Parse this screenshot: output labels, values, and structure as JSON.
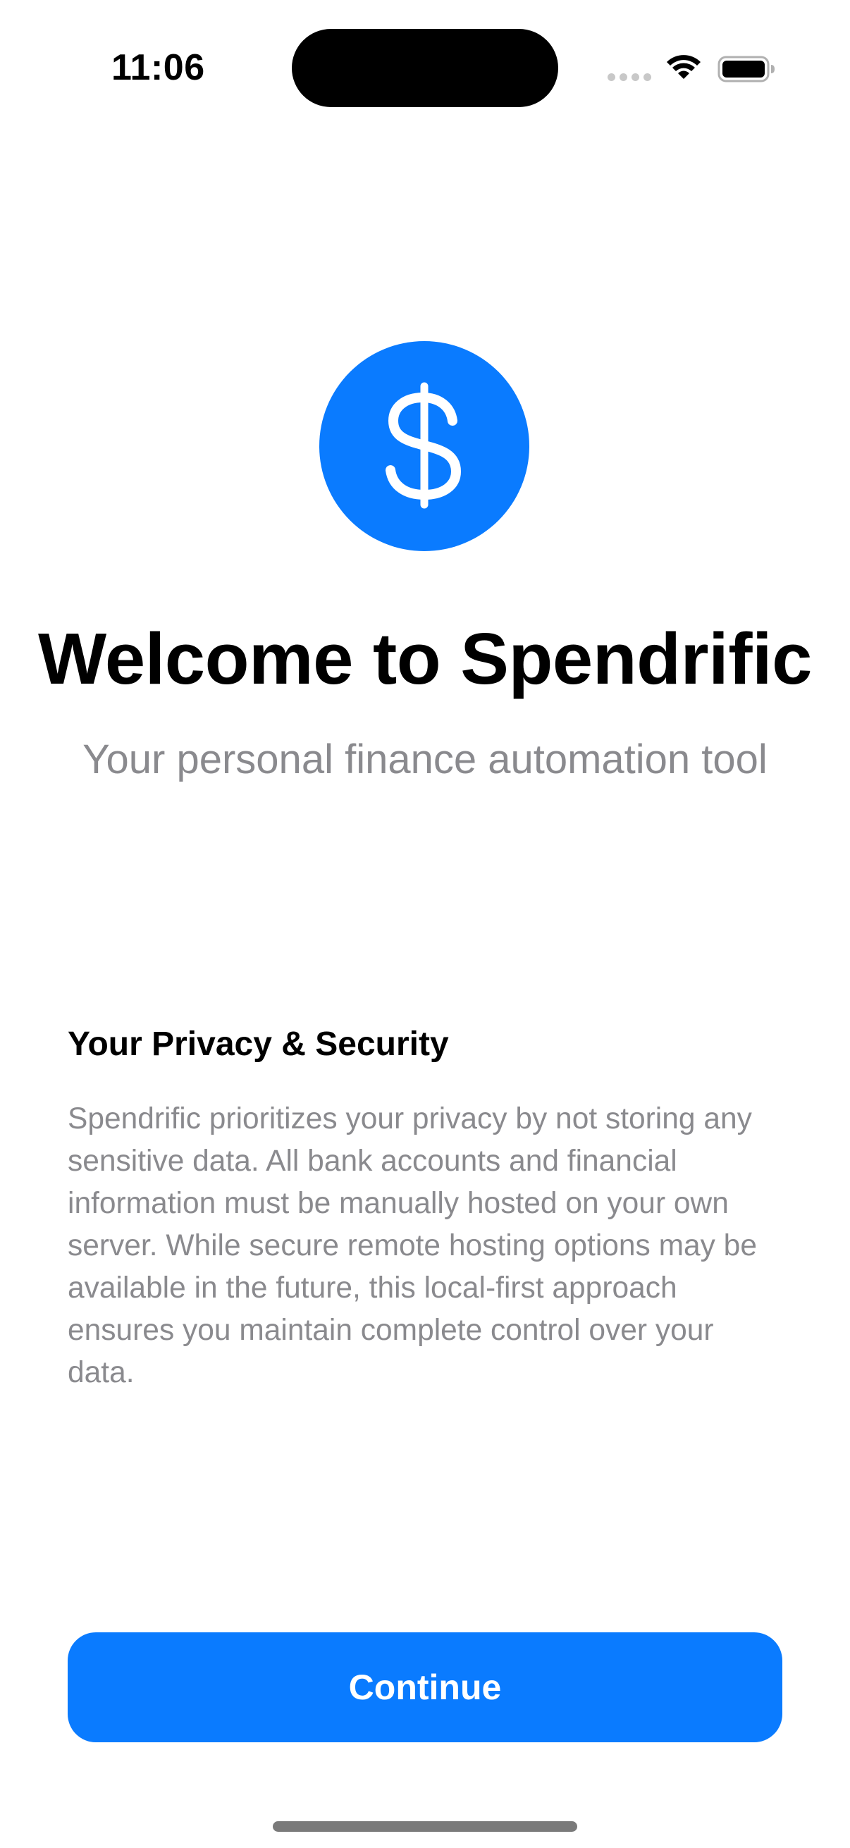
{
  "status_bar": {
    "time": "11:06",
    "icons": [
      "cellular-signal-icon",
      "wifi-icon",
      "battery-icon"
    ]
  },
  "logo": {
    "icon": "dollar-sign-icon",
    "glyph": "$",
    "background_color": "#0a7bff"
  },
  "welcome": {
    "title": "Welcome to Spendrific",
    "subtitle": "Your personal finance automation tool"
  },
  "privacy": {
    "heading": "Your Privacy & Security",
    "body": "Spendrific prioritizes your privacy by not storing any sensitive data. All bank accounts and financial information must be manually hosted on your own server. While secure remote hosting options may be available in the future, this local-first approach ensures you maintain complete control over your data."
  },
  "actions": {
    "continue_label": "Continue",
    "accent_color": "#0a7bff"
  }
}
